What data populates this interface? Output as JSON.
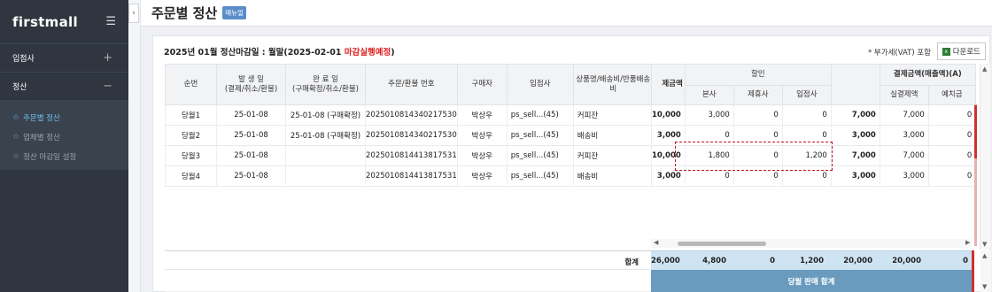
{
  "sidebar": {
    "logo": "firstmall",
    "groups": [
      {
        "label": "입점사",
        "toggle": "+"
      },
      {
        "label": "정산",
        "toggle": "−"
      }
    ],
    "sub_items": [
      {
        "label": "주문별 정산",
        "active": true
      },
      {
        "label": "업체별 정산",
        "active": false
      },
      {
        "label": "정산 마감일 설정",
        "active": false
      }
    ]
  },
  "header": {
    "title": "주문별 정산",
    "badge": "매뉴얼",
    "collapse_icon": "‹"
  },
  "panel": {
    "period_prefix": "2025년 01월 정산마감일 : 월말(2025-02-01 ",
    "period_red": "마감실행예정",
    "period_suffix": ")",
    "vat_note": "* 부가세(VAT) 포함",
    "download_label": "다운로드"
  },
  "left_columns": [
    "순번",
    "발 생 일\n(결제/취소/환불)",
    "완 료 일\n(구매확정/취소/환불)",
    "주문/환불 번호",
    "구매자",
    "입점사",
    "상품명/배송비/반품배송비"
  ],
  "right_header": {
    "payment_partial": "제금액",
    "discount": "할인",
    "discount_sub": [
      "본사",
      "제휴사",
      "입점사"
    ],
    "settle": "결제금액(매출액)(A)",
    "settle_sub": [
      "실결제액",
      "예치금"
    ]
  },
  "rows": [
    {
      "seq": "당월1",
      "occur": "25-01-08",
      "complete": "25-01-08 (구매확정)",
      "order_no": "2025010814340217530",
      "buyer": "박상우",
      "seller": "ps_sell...(45)",
      "item": "커피잔",
      "pay": "10,000",
      "d_hq": "3,000",
      "d_partner": "0",
      "d_seller": "0",
      "settle": "7,000",
      "real": "7,000",
      "deposit": "0"
    },
    {
      "seq": "당월2",
      "occur": "25-01-08",
      "complete": "25-01-08 (구매확정)",
      "order_no": "2025010814340217530",
      "buyer": "박상우",
      "seller": "ps_sell...(45)",
      "item": "배송비",
      "pay": "3,000",
      "d_hq": "0",
      "d_partner": "0",
      "d_seller": "0",
      "settle": "3,000",
      "real": "3,000",
      "deposit": "0"
    },
    {
      "seq": "당월3",
      "occur": "25-01-08",
      "complete": "",
      "order_no": "2025010814413817531",
      "buyer": "박상우",
      "seller": "ps_sell...(45)",
      "item": "커피잔",
      "pay": "10,000",
      "d_hq": "1,800",
      "d_partner": "0",
      "d_seller": "1,200",
      "settle": "7,000",
      "real": "7,000",
      "deposit": "0"
    },
    {
      "seq": "당월4",
      "occur": "25-01-08",
      "complete": "",
      "order_no": "2025010814413817531",
      "buyer": "박상우",
      "seller": "ps_sell...(45)",
      "item": "배송비",
      "pay": "3,000",
      "d_hq": "0",
      "d_partner": "0",
      "d_seller": "0",
      "settle": "3,000",
      "real": "3,000",
      "deposit": "0"
    }
  ],
  "totals": {
    "label": "합계",
    "pay": "26,000",
    "d_hq": "4,800",
    "d_partner": "0",
    "d_seller": "1,200",
    "settle": "20,000",
    "real": "20,000",
    "deposit": "0"
  },
  "month_total_label": "당월 판매 합계",
  "colors": {
    "sidebar_bg": "#2f3640",
    "active_link": "#6fc0f0",
    "accent_red": "#e02020",
    "totals_bg": "#cfe4f3",
    "month_total_bg": "#6a9bbf"
  }
}
